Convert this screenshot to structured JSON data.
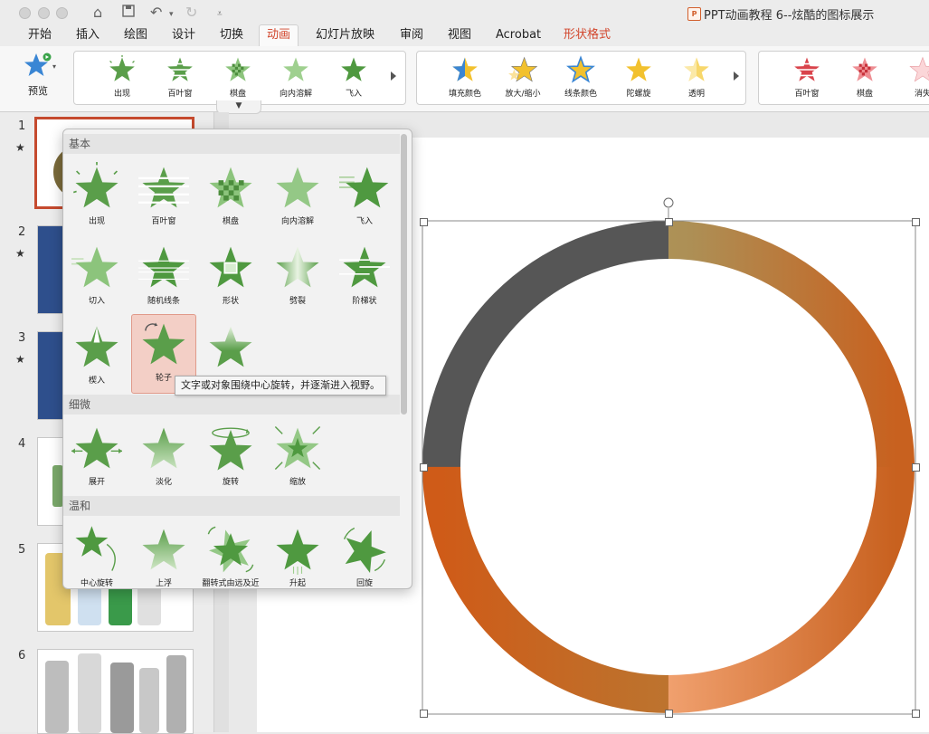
{
  "window": {
    "title": "PPT动画教程 6--炫酷的图标展示",
    "doc_badge": "P"
  },
  "titlebar_icons": [
    "home-icon",
    "save-icon",
    "undo-icon",
    "redo-icon",
    "customize-icon"
  ],
  "tabs": [
    "开始",
    "插入",
    "绘图",
    "设计",
    "切换",
    "动画",
    "幻灯片放映",
    "审阅",
    "视图",
    "Acrobat",
    "形状格式"
  ],
  "active_tab": "动画",
  "ribbon": {
    "preview_label": "预览",
    "entrance_gallery": [
      "出现",
      "百叶窗",
      "棋盘",
      "向内溶解",
      "飞入"
    ],
    "emphasis_gallery": [
      "填充颜色",
      "放大/缩小",
      "线条颜色",
      "陀螺旋",
      "透明"
    ],
    "exit_gallery": [
      "百叶窗",
      "棋盘",
      "消失"
    ]
  },
  "slides": [
    {
      "number": "1",
      "has_star": true
    },
    {
      "number": "2",
      "has_star": true
    },
    {
      "number": "3",
      "has_star": true
    },
    {
      "number": "4",
      "has_star": false
    },
    {
      "number": "5",
      "has_star": false
    },
    {
      "number": "6",
      "has_star": false
    }
  ],
  "star_glyph": "★",
  "dropdown": {
    "sections": [
      {
        "title": "基本",
        "items": [
          "出现",
          "百叶窗",
          "棋盘",
          "向内溶解",
          "飞入",
          "切入",
          "随机线条",
          "形状",
          "劈裂",
          "阶梯状",
          "楔入",
          "轮子",
          ""
        ]
      },
      {
        "title": "细微",
        "items": [
          "展开",
          "淡化",
          "旋转",
          "缩放"
        ]
      },
      {
        "title": "温和",
        "items": [
          "中心旋转",
          "上浮",
          "翻转式由远及近",
          "升起",
          "回旋"
        ]
      }
    ],
    "selected_item": "轮子",
    "tooltip": "文字或对象围绕中心旋转，并逐渐进入视野。"
  },
  "colors": {
    "accent": "#d2452b",
    "star_green": "#5a9e4a",
    "emphasis_gold": "#f2c12e",
    "exit_red": "#d9434b",
    "ring_dark": "#565656",
    "ring_olive": "#b0ab6a",
    "ring_orange": "#c8611f"
  }
}
